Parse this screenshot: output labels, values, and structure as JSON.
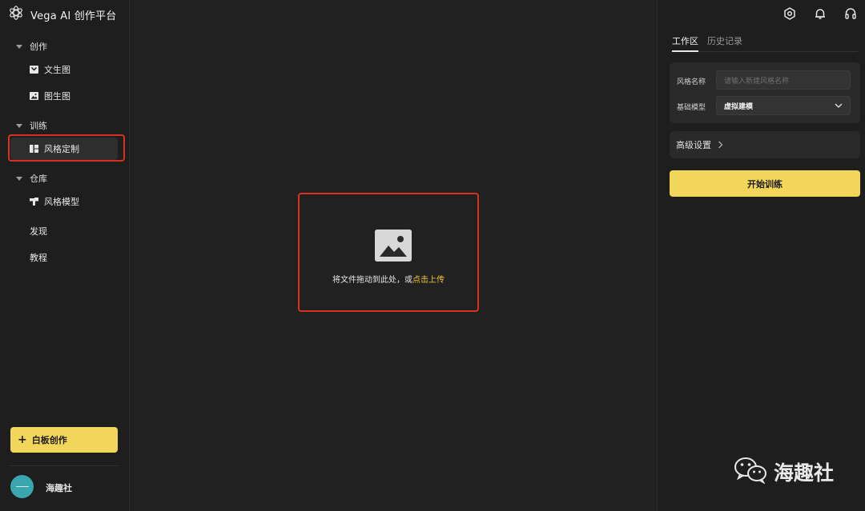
{
  "app": {
    "title": "Vega AI 创作平台"
  },
  "sidebar": {
    "sections": [
      {
        "label": "创作",
        "items": [
          {
            "label": "文生图",
            "icon": "text-to-image-icon"
          },
          {
            "label": "图生图",
            "icon": "image-to-image-icon"
          }
        ]
      },
      {
        "label": "训练",
        "items": [
          {
            "label": "风格定制",
            "icon": "style-custom-icon",
            "active": true
          }
        ]
      },
      {
        "label": "仓库",
        "items": [
          {
            "label": "风格模型",
            "icon": "style-model-icon"
          }
        ]
      }
    ],
    "top_links": [
      "发现",
      "教程"
    ],
    "whiteboard_button": "白板创作",
    "user": {
      "name": "海趣社"
    }
  },
  "upload": {
    "text": "将文件拖动到此处，或",
    "link": "点击上传"
  },
  "right_panel": {
    "header_icons": [
      "settings-icon",
      "bell-icon",
      "headset-icon"
    ],
    "tabs": [
      {
        "label": "工作区",
        "active": true
      },
      {
        "label": "历史记录",
        "active": false
      }
    ],
    "form": {
      "name_label": "风格名称",
      "name_placeholder": "请输入新建风格名称",
      "model_label": "基础模型",
      "model_value": "虚拟建模"
    },
    "advanced_label": "高级设置",
    "start_button": "开始训练"
  },
  "watermark": {
    "text": "海趣社",
    "icon": "wechat-icon"
  },
  "colors": {
    "accent": "#f2d65a",
    "highlight": "#d8321f",
    "link": "#f0c93a",
    "background": "#212121"
  }
}
